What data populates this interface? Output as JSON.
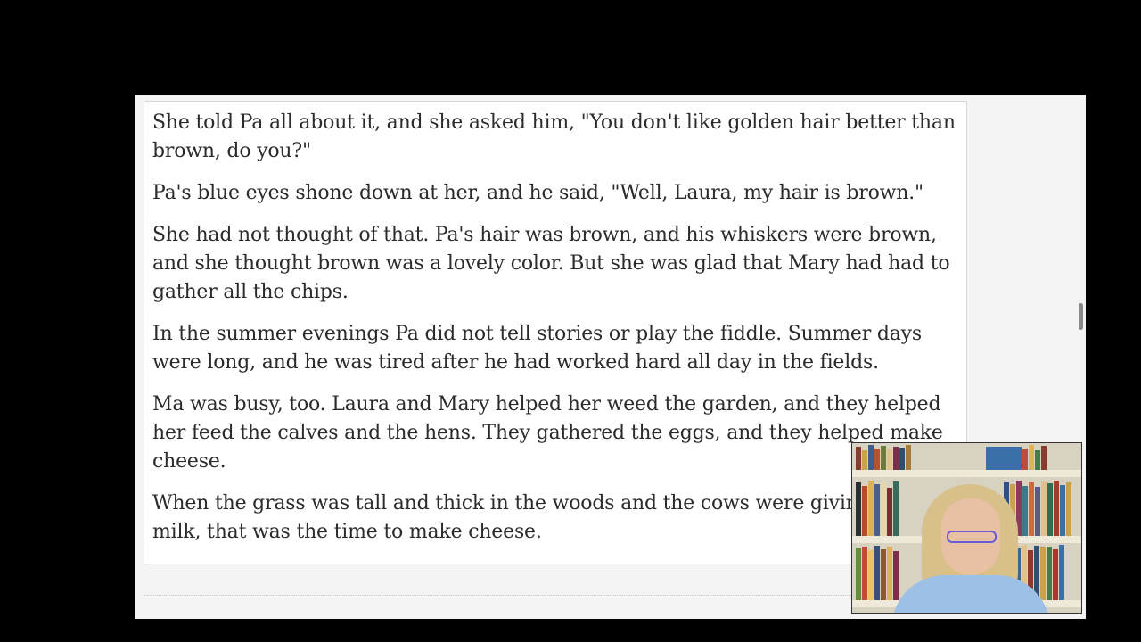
{
  "document": {
    "paragraphs": [
      "She told Pa all about it, and she asked him, \"You don't like golden hair better than brown, do you?\"",
      "Pa's blue eyes shone down at her, and he said, \"Well, Laura, my hair is brown.\"",
      "She had not thought of that. Pa's hair was brown, and his whiskers were brown, and she thought brown was a lovely color. But she was glad that Mary had had to gather all the chips.",
      "In the summer evenings Pa did not tell stories or play the fiddle. Summer days were long, and he was tired after he had worked hard all day in the fields.",
      "Ma was busy, too. Laura and Mary helped her weed the garden, and they helped her feed the calves and the hens. They gathered the eggs, and they helped make cheese.",
      "When the grass was tall and thick in the woods and the cows were giving lots of milk, that was the time to make cheese."
    ]
  },
  "colors": {
    "background": "#000000",
    "page": "#ffffff",
    "text": "#2b2b2b"
  },
  "icons": {
    "webcam": "presenter-webcam-video"
  }
}
